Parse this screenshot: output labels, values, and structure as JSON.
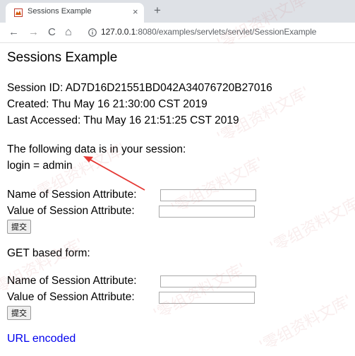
{
  "browser": {
    "tab_title": "Sessions Example",
    "close_glyph": "×",
    "newtab_glyph": "+",
    "back_glyph": "←",
    "forward_glyph": "→",
    "reload_glyph": "C",
    "home_glyph": "⌂",
    "url_host": "127.0.0.1",
    "url_path": ":8080/examples/servlets/servlet/SessionExample"
  },
  "page": {
    "heading": "Sessions Example",
    "session_id": "Session ID: AD7D16D21551BD042A34076720B27016",
    "created": "Created: Thu May 16 21:30:00 CST 2019",
    "last_accessed": "Last Accessed: Thu May 16 21:51:25 CST 2019",
    "data_intro": "The following data is in your session:",
    "data_entry": "login = admin",
    "form1": {
      "name_label": "Name of Session Attribute:",
      "value_label": "Value of Session Attribute:",
      "name_value": "",
      "value_value": "",
      "submit_label": "提交"
    },
    "get_form_label": "GET based form:",
    "form2": {
      "name_label": "Name of Session Attribute:",
      "value_label": "Value of Session Attribute:",
      "name_value": "",
      "value_value": "",
      "submit_label": "提交"
    },
    "url_encoded_link": "URL encoded"
  },
  "colors": {
    "annotation_arrow": "#e53935",
    "link": "#0000ee"
  },
  "watermark": "'零组资料文库'"
}
